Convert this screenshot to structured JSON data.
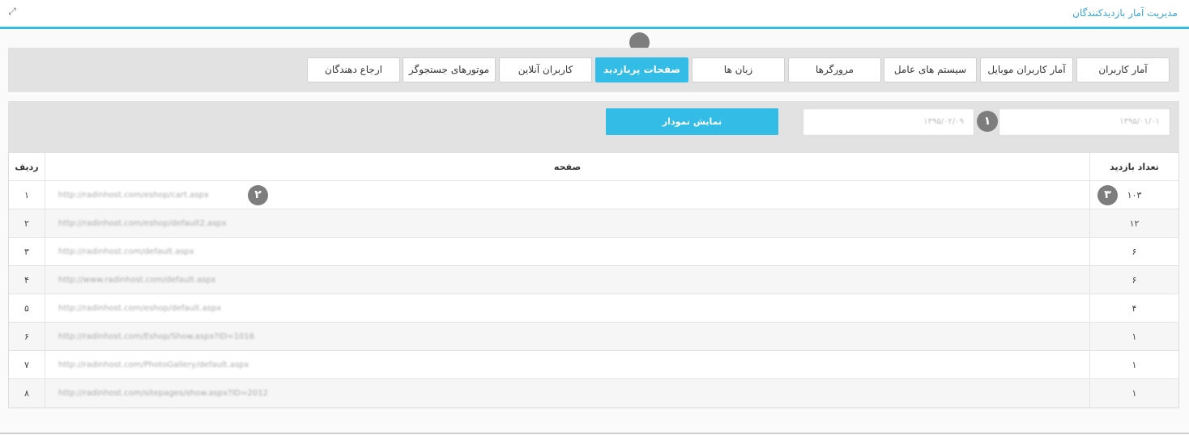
{
  "header": {
    "title": "مدیریت آمار بازدیدکنندگان",
    "expand_icon": "expand-icon"
  },
  "tabs": [
    {
      "label": "آمار کاربران",
      "active": false
    },
    {
      "label": "آمار کاربران موبایل",
      "active": false
    },
    {
      "label": "سیستم های عامل",
      "active": false
    },
    {
      "label": "مرورگرها",
      "active": false
    },
    {
      "label": "زبان ها",
      "active": false
    },
    {
      "label": "صفحات پربازدید",
      "active": true
    },
    {
      "label": "کاربران آنلاین",
      "active": false
    },
    {
      "label": "موتورهای جستجوگر",
      "active": false
    },
    {
      "label": "ارجاع دهندگان",
      "active": false
    }
  ],
  "filter": {
    "from_date": "۱۳۹۵/۰۱/۰۱",
    "to_date": "۱۳۹۵/۰۲/۰۹",
    "show_chart_label": "نمایش نمودار"
  },
  "markers": {
    "top": "",
    "one": "۱",
    "two": "۲",
    "three": "۳"
  },
  "table": {
    "columns": {
      "visits": "تعداد بازدید",
      "page": "صفحه",
      "row": "ردیف"
    },
    "rows": [
      {
        "row": "۱",
        "page": "http://radinhost.com/eshop/cart.aspx",
        "visits": "۱۰۳"
      },
      {
        "row": "۲",
        "page": "http://radinhost.com/eshop/default2.aspx",
        "visits": "۱۲"
      },
      {
        "row": "۳",
        "page": "http://radinhost.com/default.aspx",
        "visits": "۶"
      },
      {
        "row": "۴",
        "page": "http://www.radinhost.com/default.aspx",
        "visits": "۶"
      },
      {
        "row": "۵",
        "page": "http://radinhost.com/eshop/default.aspx",
        "visits": "۴"
      },
      {
        "row": "۶",
        "page": "http://radinhost.com/Eshop/Show.aspx?ID=1016",
        "visits": "۱"
      },
      {
        "row": "۷",
        "page": "http://radinhost.com/PhotoGallery/default.aspx",
        "visits": "۱"
      },
      {
        "row": "۸",
        "page": "http://radinhost.com/sitepages/show.aspx?ID=2012",
        "visits": "۱"
      }
    ]
  },
  "colors": {
    "accent": "#33bde6",
    "title": "#3aa6d4",
    "marker": "#7d7d7d"
  }
}
